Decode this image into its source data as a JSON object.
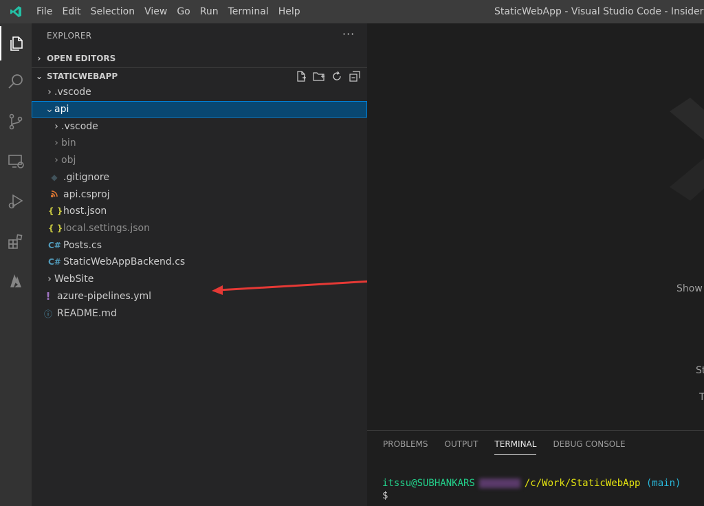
{
  "titlebar": {
    "menu": [
      "File",
      "Edit",
      "Selection",
      "View",
      "Go",
      "Run",
      "Terminal",
      "Help"
    ],
    "title": "StaticWebApp - Visual Studio Code - Insiders"
  },
  "sidebar": {
    "header": "EXPLORER",
    "more": "···",
    "open_editors": "OPEN EDITORS",
    "project": "STATICWEBAPP",
    "items": [
      {
        "label": ".vscode"
      },
      {
        "label": "api"
      },
      {
        "label": ".vscode"
      },
      {
        "label": "bin"
      },
      {
        "label": "obj"
      },
      {
        "label": ".gitignore"
      },
      {
        "label": "api.csproj"
      },
      {
        "label": "host.json"
      },
      {
        "label": "local.settings.json"
      },
      {
        "label": "Posts.cs"
      },
      {
        "label": "StaticWebAppBackend.cs"
      },
      {
        "label": "WebSite"
      },
      {
        "label": "azure-pipelines.yml"
      },
      {
        "label": "README.md"
      }
    ]
  },
  "editor": {
    "hint1": "Show",
    "hint2": "St",
    "hint3": "T"
  },
  "panel": {
    "tabs": [
      "PROBLEMS",
      "OUTPUT",
      "TERMINAL",
      "DEBUG CONSOLE"
    ],
    "terminal": {
      "user": "itssu@SUBHANKARS",
      "path": "/c/Work/StaticWebApp",
      "branch": "(main)",
      "prompt": "$"
    }
  },
  "colors": {
    "accent": "#007fd4",
    "selection": "#094771",
    "arrow": "#e53935"
  }
}
